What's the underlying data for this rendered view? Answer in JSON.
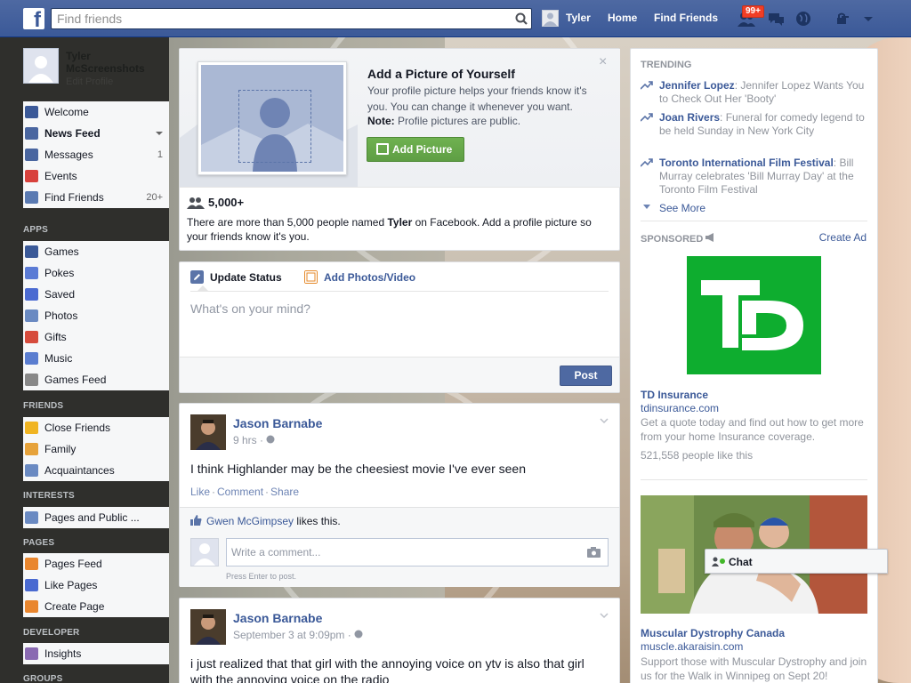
{
  "topbar": {
    "logo_letter": "f",
    "search_placeholder": "Find friends",
    "user_name": "Tyler",
    "home_label": "Home",
    "find_friends_label": "Find Friends",
    "friend_requests_badge": "99+"
  },
  "sidebar": {
    "profile_name": "Tyler McScreenshots",
    "edit_profile": "Edit Profile",
    "favorites": [
      {
        "label": "Welcome",
        "count": "",
        "color": "#3b5998"
      },
      {
        "label": "News Feed",
        "count": "",
        "color": "#4a66a0"
      },
      {
        "label": "Messages",
        "count": "1",
        "color": "#4a66a0"
      },
      {
        "label": "Events",
        "count": "",
        "color": "#d8413c"
      },
      {
        "label": "Find Friends",
        "count": "20+",
        "color": "#5a7ab2"
      }
    ],
    "apps_header": "APPS",
    "apps": [
      {
        "label": "Games",
        "color": "#3a5998"
      },
      {
        "label": "Pokes",
        "color": "#5b7bd5"
      },
      {
        "label": "Saved",
        "color": "#4b6ad1"
      },
      {
        "label": "Photos",
        "color": "#6a8ac2"
      },
      {
        "label": "Gifts",
        "color": "#d64b3c"
      },
      {
        "label": "Music",
        "color": "#5a7dd0"
      },
      {
        "label": "Games Feed",
        "color": "#888888"
      }
    ],
    "friends_header": "FRIENDS",
    "friends": [
      {
        "label": "Close Friends",
        "color": "#f0b422"
      },
      {
        "label": "Family",
        "color": "#e6a23a"
      },
      {
        "label": "Acquaintances",
        "color": "#6a8ac2"
      }
    ],
    "interests_header": "INTERESTS",
    "interests": [
      {
        "label": "Pages and Public ...",
        "color": "#6a8ac2"
      }
    ],
    "pages_header": "PAGES",
    "pages": [
      {
        "label": "Pages Feed",
        "color": "#e9862e"
      },
      {
        "label": "Like Pages",
        "color": "#4a6ad1"
      },
      {
        "label": "Create Page",
        "color": "#e9862e"
      }
    ],
    "developer_header": "DEVELOPER",
    "developer": [
      {
        "label": "Insights",
        "color": "#8a6ab2"
      }
    ],
    "groups_header": "GROUPS"
  },
  "add_picture": {
    "title": "Add a Picture of Yourself",
    "description": "Your profile picture helps your friends know it's you. You can change it whenever you want.",
    "note_label": "Note:",
    "note_text": "Profile pictures are public.",
    "button_label": "Add Picture",
    "close_glyph": "×",
    "count": "5,000+",
    "count_text_before": "There are more than 5,000 people named ",
    "count_name": "Tyler",
    "count_text_after": " on Facebook. Add a profile picture so your friends know it's you."
  },
  "composer": {
    "tab_status": "Update Status",
    "tab_photos": "Add Photos/Video",
    "placeholder": "What's on your mind?",
    "post_button": "Post"
  },
  "posts": [
    {
      "author": "Jason Barnabe",
      "time": "9 hrs",
      "text": "I think Highlander may be the cheesiest movie I've ever seen",
      "like": "Like",
      "comment": "Comment",
      "share": "Share",
      "liker": "Gwen McGimpsey",
      "likes_suffix": " likes this.",
      "comment_placeholder": "Write a comment...",
      "press_enter": "Press Enter to post."
    },
    {
      "author": "Jason Barnabe",
      "time": "September 3 at 9:09pm",
      "text": "i just realized that that girl with the annoying voice on ytv is also that girl with the annoying voice on the radio"
    }
  ],
  "trending": {
    "header": "TRENDING",
    "items": [
      {
        "topic": "Jennifer Lopez",
        "desc": ": Jennifer Lopez Wants You to Check Out Her 'Booty'"
      },
      {
        "topic": "Joan Rivers",
        "desc": ": Funeral for comedy legend to be held Sunday in New York City"
      },
      {
        "topic": "Toronto International Film Festival",
        "desc": ": Bill Murray celebrates 'Bill Murray Day' at the Toronto Film Festival"
      }
    ],
    "see_more": "See More"
  },
  "sponsored": {
    "header": "SPONSORED",
    "create_ad": "Create Ad",
    "ads": [
      {
        "logo_text": "TD",
        "title": "TD Insurance",
        "url": "tdinsurance.com",
        "body": "Get a quote today and find out how to get more from your home Insurance coverage.",
        "likes": "521,558 people like this"
      },
      {
        "title": "Muscular Dystrophy Canada",
        "url": "muscle.akaraisin.com",
        "body": "Support those with Muscular Dystrophy and join us for the Walk in Winnipeg on Sept 20!"
      }
    ]
  },
  "chat": {
    "label": "Chat"
  },
  "colors": {
    "brand": "#3b5998",
    "topbar": "#4e69a2",
    "add_picture_green": "#69a74e",
    "td_green": "#0ead2f",
    "notification_red": "#f03d25"
  }
}
